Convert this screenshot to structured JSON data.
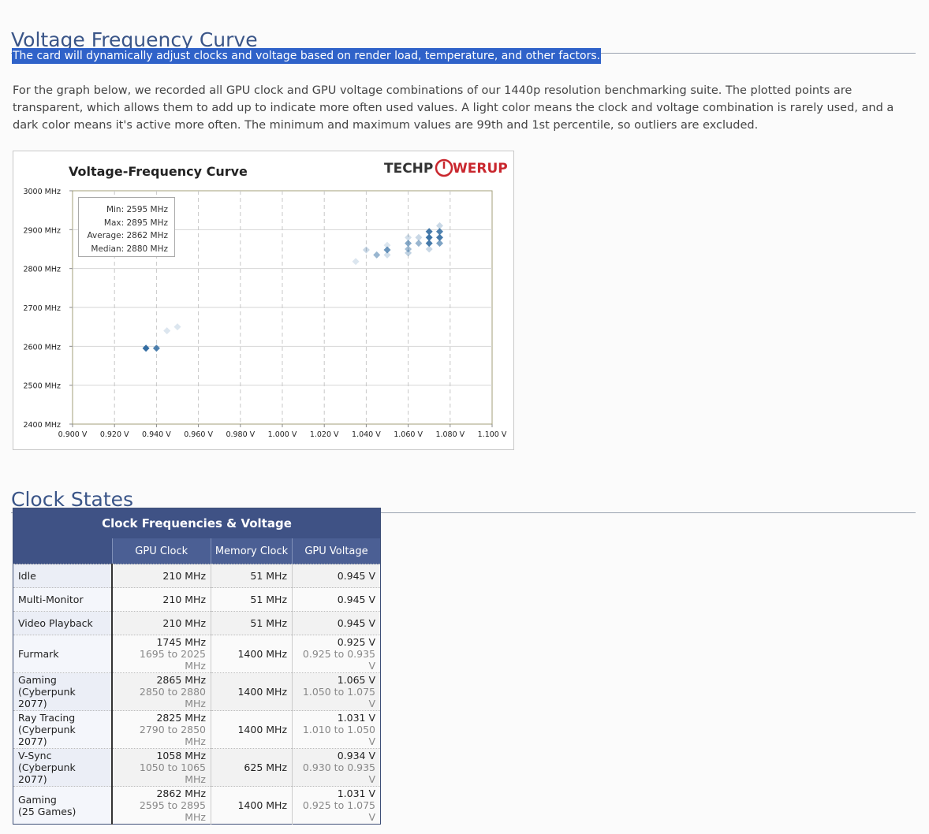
{
  "section_vfc": {
    "title": "Voltage Frequency Curve"
  },
  "highlight_text": "The card will dynamically adjust clocks and voltage based on render load, temperature, and other factors.",
  "paragraph": "For the graph below, we recorded all GPU clock and GPU voltage combinations of our 1440p resolution benchmarking suite. The plotted points are transparent, which allows them to add up to indicate more often used values. A light color means the clock and voltage combination is rarely used, and a dark color means it's active more often. The minimum and maximum values are 99th and 1st percentile, so outliers are excluded.",
  "logo": {
    "part1": "TECHP",
    "part2": "WERUP"
  },
  "stats": {
    "min": "Min: 2595 MHz",
    "max": "Max: 2895 MHz",
    "average": "Average: 2862 MHz",
    "median": "Median: 2880 MHz"
  },
  "chart_data": {
    "type": "scatter",
    "title": "Voltage-Frequency  Curve",
    "xlabel": "",
    "ylabel": "",
    "xlim": [
      0.9,
      1.1
    ],
    "ylim": [
      2400,
      3000
    ],
    "x_ticks": [
      "0.900 V",
      "0.920 V",
      "0.940 V",
      "0.960 V",
      "0.980 V",
      "1.000 V",
      "1.020 V",
      "1.040 V",
      "1.060 V",
      "1.080 V",
      "1.100 V"
    ],
    "y_ticks": [
      "3000 MHz",
      "2900 MHz",
      "2800 MHz",
      "2700 MHz",
      "2600 MHz",
      "2500 MHz",
      "2400 MHz"
    ],
    "grid": true,
    "point_color": "#2f6aa0",
    "points": [
      {
        "x": 0.935,
        "y": 2595,
        "density": 1.0
      },
      {
        "x": 0.94,
        "y": 2595,
        "density": 0.85
      },
      {
        "x": 0.945,
        "y": 2640,
        "density": 0.1
      },
      {
        "x": 0.95,
        "y": 2650,
        "density": 0.1
      },
      {
        "x": 1.035,
        "y": 2818,
        "density": 0.1
      },
      {
        "x": 1.04,
        "y": 2848,
        "density": 0.2
      },
      {
        "x": 1.045,
        "y": 2835,
        "density": 0.45
      },
      {
        "x": 1.05,
        "y": 2848,
        "density": 0.7
      },
      {
        "x": 1.05,
        "y": 2835,
        "density": 0.15
      },
      {
        "x": 1.05,
        "y": 2860,
        "density": 0.1
      },
      {
        "x": 1.06,
        "y": 2840,
        "density": 0.25
      },
      {
        "x": 1.06,
        "y": 2850,
        "density": 0.4
      },
      {
        "x": 1.06,
        "y": 2865,
        "density": 0.55
      },
      {
        "x": 1.06,
        "y": 2880,
        "density": 0.15
      },
      {
        "x": 1.065,
        "y": 2865,
        "density": 0.45
      },
      {
        "x": 1.065,
        "y": 2880,
        "density": 0.2
      },
      {
        "x": 1.07,
        "y": 2865,
        "density": 0.9
      },
      {
        "x": 1.07,
        "y": 2880,
        "density": 0.95
      },
      {
        "x": 1.07,
        "y": 2895,
        "density": 0.9
      },
      {
        "x": 1.07,
        "y": 2850,
        "density": 0.2
      },
      {
        "x": 1.075,
        "y": 2865,
        "density": 0.6
      },
      {
        "x": 1.075,
        "y": 2880,
        "density": 0.9
      },
      {
        "x": 1.075,
        "y": 2895,
        "density": 0.85
      },
      {
        "x": 1.075,
        "y": 2910,
        "density": 0.2
      }
    ]
  },
  "section_cs": {
    "title": "Clock States"
  },
  "clock_table": {
    "caption": "Clock Frequencies & Voltage",
    "headers": [
      "GPU Clock",
      "Memory Clock",
      "GPU Voltage"
    ],
    "rows": [
      {
        "label": [
          "Idle"
        ],
        "gpu": [
          "210 MHz"
        ],
        "mem": "51 MHz",
        "volt": [
          "0.945 V"
        ]
      },
      {
        "label": [
          "Multi-Monitor"
        ],
        "gpu": [
          "210 MHz"
        ],
        "mem": "51 MHz",
        "volt": [
          "0.945 V"
        ]
      },
      {
        "label": [
          "Video Playback"
        ],
        "gpu": [
          "210 MHz"
        ],
        "mem": "51 MHz",
        "volt": [
          "0.945 V"
        ]
      },
      {
        "label": [
          "Furmark"
        ],
        "gpu": [
          "1745 MHz",
          "1695 to 2025 MHz"
        ],
        "mem": "1400 MHz",
        "volt": [
          "0.925 V",
          "0.925 to 0.935 V"
        ]
      },
      {
        "label": [
          "Gaming",
          "(Cyberpunk 2077)"
        ],
        "gpu": [
          "2865 MHz",
          "2850 to 2880 MHz"
        ],
        "mem": "1400 MHz",
        "volt": [
          "1.065 V",
          "1.050 to 1.075 V"
        ]
      },
      {
        "label": [
          "Ray Tracing",
          "(Cyberpunk 2077)"
        ],
        "gpu": [
          "2825 MHz",
          "2790 to 2850 MHz"
        ],
        "mem": "1400 MHz",
        "volt": [
          "1.031 V",
          "1.010 to 1.050 V"
        ]
      },
      {
        "label": [
          "V-Sync",
          "(Cyberpunk 2077)"
        ],
        "gpu": [
          "1058 MHz",
          "1050 to 1065 MHz"
        ],
        "mem": "625 MHz",
        "volt": [
          "0.934 V",
          "0.930 to 0.935 V"
        ]
      },
      {
        "label": [
          "Gaming",
          "(25 Games)"
        ],
        "gpu": [
          "2862 MHz",
          "2595 to 2895 MHz"
        ],
        "mem": "1400 MHz",
        "volt": [
          "1.031 V",
          "0.925 to 1.075 V"
        ]
      }
    ]
  }
}
